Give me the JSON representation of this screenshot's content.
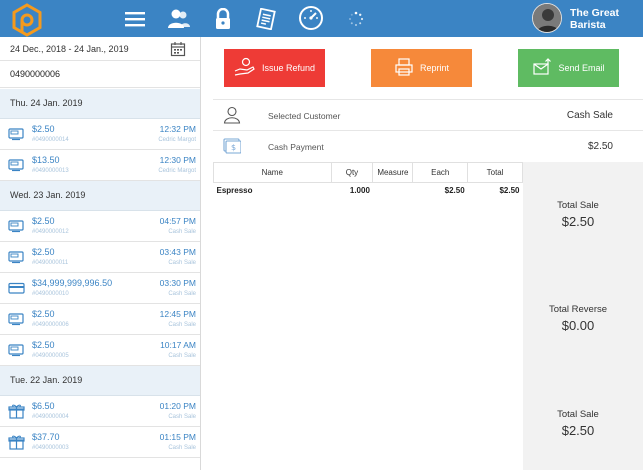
{
  "header": {
    "nav_icons": [
      "menu-icon",
      "customers-icon",
      "lock-icon",
      "reports-icon",
      "dashboard-gauge-icon",
      "loading-spinner-icon"
    ],
    "user_name_line1": "The Great",
    "user_name_line2": "Barista",
    "accent_color": "#3b84c4"
  },
  "sidebar": {
    "date_range": "24 Dec., 2018 - 24 Jan., 2019",
    "search_value": "0490000006",
    "groups": [
      {
        "day": "Thu. 24 Jan. 2019",
        "rows": [
          {
            "icon": "eftpos-icon",
            "amount": "$2.50",
            "number": "#0490000014",
            "time": "12:32 PM",
            "who": "Cedric Margot"
          },
          {
            "icon": "eftpos-icon",
            "amount": "$13.50",
            "number": "#0490000013",
            "time": "12:30 PM",
            "who": "Cedric Margot"
          }
        ]
      },
      {
        "day": "Wed. 23 Jan. 2019",
        "rows": [
          {
            "icon": "cash-icon",
            "amount": "$2.50",
            "number": "#0490000012",
            "time": "04:57 PM",
            "who": "Cash Sale"
          },
          {
            "icon": "cash-icon",
            "amount": "$2.50",
            "number": "#0490000011",
            "time": "03:43 PM",
            "who": "Cash Sale"
          },
          {
            "icon": "card-icon",
            "amount": "$34,999,999,996.50",
            "number": "#0490000010",
            "time": "03:30 PM",
            "who": "Cash Sale"
          },
          {
            "icon": "cash-icon",
            "amount": "$2.50",
            "number": "#0490000006",
            "time": "12:45 PM",
            "who": "Cash Sale"
          },
          {
            "icon": "cash-icon",
            "amount": "$2.50",
            "number": "#0490000005",
            "time": "10:17 AM",
            "who": "Cash Sale"
          }
        ]
      },
      {
        "day": "Tue. 22 Jan. 2019",
        "rows": [
          {
            "icon": "gift-icon",
            "amount": "$6.50",
            "number": "#0490000004",
            "time": "01:20 PM",
            "who": "Cash Sale"
          },
          {
            "icon": "gift-icon",
            "amount": "$37.70",
            "number": "#0490000003",
            "time": "01:15 PM",
            "who": "Cash Sale"
          }
        ]
      }
    ]
  },
  "actions": {
    "refund_label": "Issue Refund",
    "reprint_label": "Reprint",
    "email_label": "Send Email",
    "refund_color": "#ee3b36",
    "reprint_color": "#f6893a",
    "email_color": "#5fbb62"
  },
  "detail": {
    "customer_label": "Selected Customer",
    "customer_value": "Cash Sale",
    "payment_label": "Cash Payment",
    "payment_value": "$2.50"
  },
  "items_table": {
    "headers": [
      "Name",
      "Qty",
      "Measure",
      "Each",
      "Total"
    ],
    "rows": [
      {
        "name": "Espresso",
        "qty": "1.000",
        "measure": "",
        "each": "$2.50",
        "total": "$2.50"
      }
    ]
  },
  "totals": {
    "sale_label": "Total Sale",
    "sale_value": "$2.50",
    "reverse_label": "Total Reverse",
    "reverse_value": "$0.00",
    "final_label": "Total Sale",
    "final_value": "$2.50"
  }
}
